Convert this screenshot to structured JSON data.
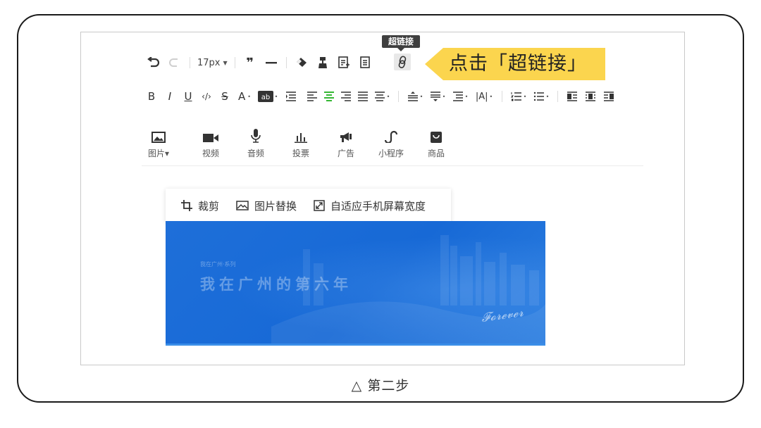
{
  "toolbar": {
    "font_size": "17px",
    "tooltip": "超链接"
  },
  "callout": {
    "text": "点击「超链接」"
  },
  "insert_items": [
    {
      "label": "图片",
      "icon": "image-icon",
      "has_dropdown": true
    },
    {
      "label": "视频",
      "icon": "video-icon"
    },
    {
      "label": "音频",
      "icon": "microphone-icon"
    },
    {
      "label": "投票",
      "icon": "vote-icon"
    },
    {
      "label": "广告",
      "icon": "ad-icon"
    },
    {
      "label": "小程序",
      "icon": "mini-program-icon"
    },
    {
      "label": "商品",
      "icon": "product-icon"
    }
  ],
  "image_toolbar": {
    "crop": "裁剪",
    "replace": "图片替换",
    "fit_mobile": "自适应手机屏幕宽度"
  },
  "banner": {
    "small_title": "我在广州·系列",
    "title": "我在广州的第六年",
    "signature": "𝓕𝓸𝓻𝓮𝓿𝓮𝓻"
  },
  "caption": "△ 第二步",
  "colors": {
    "callout": "#fbd54e",
    "banner_blue": "#1769d6",
    "active_align_green": "#1aad19"
  }
}
